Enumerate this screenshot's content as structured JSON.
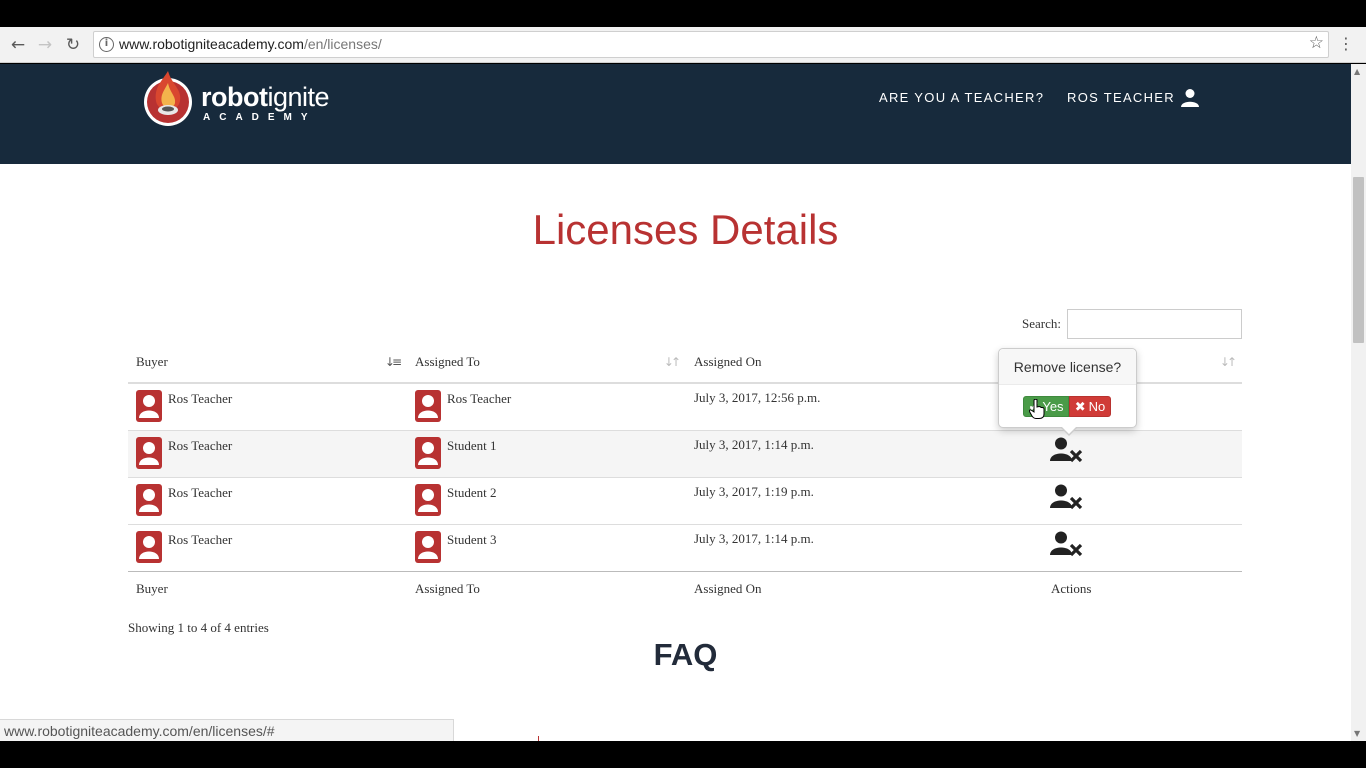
{
  "browser": {
    "url_host": "www.robotigniteacademy.com",
    "url_path": "/en/licenses/",
    "status_url": "www.robotigniteacademy.com/en/licenses/#"
  },
  "header": {
    "logo_word_1": "robot",
    "logo_word_2": "ignite",
    "logo_sub": "ACADEMY",
    "teacher_link": "ARE YOU A TEACHER?",
    "user_link": "ROS TEACHER"
  },
  "page": {
    "title": "Licenses Details",
    "search_label": "Search:",
    "search_value": ""
  },
  "table": {
    "headers": [
      "Buyer",
      "Assigned To",
      "Assigned On",
      "Actions"
    ],
    "rows": [
      {
        "buyer": "Ros Teacher",
        "assigned_to": "Ros Teacher",
        "assigned_on": "July 3, 2017, 12:56 p.m."
      },
      {
        "buyer": "Ros Teacher",
        "assigned_to": "Student 1",
        "assigned_on": "July 3, 2017, 1:14 p.m."
      },
      {
        "buyer": "Ros Teacher",
        "assigned_to": "Student 2",
        "assigned_on": "July 3, 2017, 1:19 p.m."
      },
      {
        "buyer": "Ros Teacher",
        "assigned_to": "Student 3",
        "assigned_on": "July 3, 2017, 1:14 p.m."
      }
    ],
    "info": "Showing 1 to 4 of 4 entries"
  },
  "popover": {
    "title": "Remove license?",
    "yes_label": "Yes",
    "no_label": "No"
  },
  "faq": {
    "title": "FAQ"
  },
  "colors": {
    "header_bg": "#172a3c",
    "accent_red": "#b83232",
    "yes_green": "#4a9b48",
    "no_red": "#d03b37"
  }
}
